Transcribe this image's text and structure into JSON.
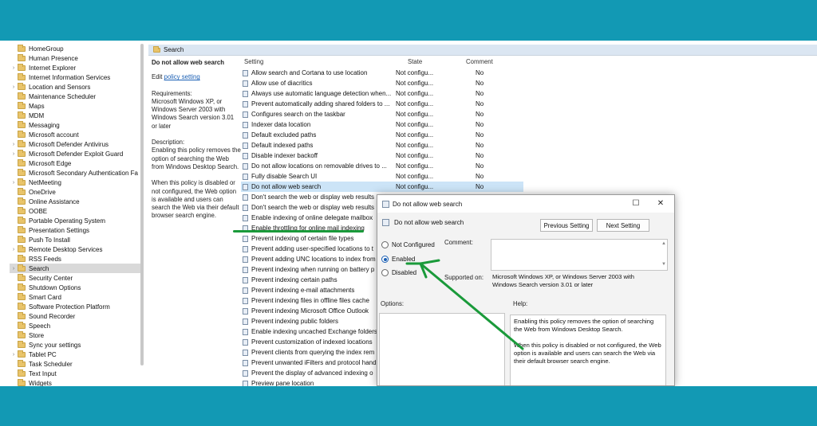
{
  "tree": {
    "items": [
      {
        "label": "HomeGroup",
        "expandable": false
      },
      {
        "label": "Human Presence",
        "expandable": false
      },
      {
        "label": "Internet Explorer",
        "expandable": true
      },
      {
        "label": "Internet Information Services",
        "expandable": false
      },
      {
        "label": "Location and Sensors",
        "expandable": true
      },
      {
        "label": "Maintenance Scheduler",
        "expandable": false
      },
      {
        "label": "Maps",
        "expandable": false
      },
      {
        "label": "MDM",
        "expandable": false
      },
      {
        "label": "Messaging",
        "expandable": false
      },
      {
        "label": "Microsoft account",
        "expandable": false
      },
      {
        "label": "Microsoft Defender Antivirus",
        "expandable": true
      },
      {
        "label": "Microsoft Defender Exploit Guard",
        "expandable": true
      },
      {
        "label": "Microsoft Edge",
        "expandable": false
      },
      {
        "label": "Microsoft Secondary Authentication Fa",
        "expandable": false
      },
      {
        "label": "NetMeeting",
        "expandable": true
      },
      {
        "label": "OneDrive",
        "expandable": false
      },
      {
        "label": "Online Assistance",
        "expandable": false
      },
      {
        "label": "OOBE",
        "expandable": false
      },
      {
        "label": "Portable Operating System",
        "expandable": false
      },
      {
        "label": "Presentation Settings",
        "expandable": false
      },
      {
        "label": "Push To Install",
        "expandable": false
      },
      {
        "label": "Remote Desktop Services",
        "expandable": true
      },
      {
        "label": "RSS Feeds",
        "expandable": false
      },
      {
        "label": "Search",
        "expandable": true,
        "selected": true
      },
      {
        "label": "Security Center",
        "expandable": false
      },
      {
        "label": "Shutdown Options",
        "expandable": false
      },
      {
        "label": "Smart Card",
        "expandable": false
      },
      {
        "label": "Software Protection Platform",
        "expandable": false
      },
      {
        "label": "Sound Recorder",
        "expandable": false
      },
      {
        "label": "Speech",
        "expandable": false
      },
      {
        "label": "Store",
        "expandable": false
      },
      {
        "label": "Sync your settings",
        "expandable": false
      },
      {
        "label": "Tablet PC",
        "expandable": true
      },
      {
        "label": "Task Scheduler",
        "expandable": false
      },
      {
        "label": "Text Input",
        "expandable": false
      },
      {
        "label": "Widgets",
        "expandable": false
      }
    ]
  },
  "pane": {
    "header": "Search",
    "desc": {
      "title": "Do not allow web search",
      "edit_prefix": "Edit ",
      "edit_link": "policy setting",
      "requirements": "Requirements:\nMicrosoft Windows XP, or Windows Server 2003 with Windows Search version 3.01 or later",
      "description": "Description:\nEnabling this policy removes the option of searching the Web from Windows Desktop Search.",
      "description2": "When this policy is disabled or not configured, the Web option is available and users can search the Web via their default browser search engine."
    }
  },
  "list": {
    "headers": {
      "setting": "Setting",
      "state": "State",
      "comment": "Comment"
    },
    "rows": [
      {
        "name": "Allow search and Cortana to use location",
        "state": "Not configu...",
        "comment": "No"
      },
      {
        "name": "Allow use of diacritics",
        "state": "Not configu...",
        "comment": "No"
      },
      {
        "name": "Always use automatic language detection when...",
        "state": "Not configu...",
        "comment": "No"
      },
      {
        "name": "Prevent automatically adding shared folders to ...",
        "state": "Not configu...",
        "comment": "No"
      },
      {
        "name": "Configures search on the taskbar",
        "state": "Not configu...",
        "comment": "No"
      },
      {
        "name": "Indexer data location",
        "state": "Not configu...",
        "comment": "No"
      },
      {
        "name": "Default excluded paths",
        "state": "Not configu...",
        "comment": "No"
      },
      {
        "name": "Default indexed paths",
        "state": "Not configu...",
        "comment": "No"
      },
      {
        "name": "Disable indexer backoff",
        "state": "Not configu...",
        "comment": "No"
      },
      {
        "name": "Do not allow locations on removable drives to ...",
        "state": "Not configu...",
        "comment": "No"
      },
      {
        "name": "Fully disable Search UI",
        "state": "Not configu...",
        "comment": "No"
      },
      {
        "name": "Do not allow web search",
        "state": "Not configu...",
        "comment": "No",
        "highlight": true
      },
      {
        "name": "Don't search the web or display web results",
        "state": "",
        "comment": ""
      },
      {
        "name": "Don't search the web or display web results",
        "state": "",
        "comment": ""
      },
      {
        "name": "Enable indexing of online delegate mailbox",
        "state": "",
        "comment": ""
      },
      {
        "name": "Enable throttling for online mail indexing",
        "state": "",
        "comment": ""
      },
      {
        "name": "Prevent indexing of certain file types",
        "state": "",
        "comment": ""
      },
      {
        "name": "Prevent adding user-specified locations to t",
        "state": "",
        "comment": ""
      },
      {
        "name": "Prevent adding UNC locations to index from",
        "state": "",
        "comment": ""
      },
      {
        "name": "Prevent indexing when running on battery p",
        "state": "",
        "comment": ""
      },
      {
        "name": "Prevent indexing certain paths",
        "state": "",
        "comment": ""
      },
      {
        "name": "Prevent indexing e-mail attachments",
        "state": "",
        "comment": ""
      },
      {
        "name": "Prevent indexing files in offline files cache",
        "state": "",
        "comment": ""
      },
      {
        "name": "Prevent indexing Microsoft Office Outlook",
        "state": "",
        "comment": ""
      },
      {
        "name": "Prevent indexing public folders",
        "state": "",
        "comment": ""
      },
      {
        "name": "Enable indexing uncached Exchange folders",
        "state": "",
        "comment": ""
      },
      {
        "name": "Prevent customization of indexed locations",
        "state": "",
        "comment": ""
      },
      {
        "name": "Prevent clients from querying the index rem",
        "state": "",
        "comment": ""
      },
      {
        "name": "Prevent unwanted iFilters and protocol hand",
        "state": "",
        "comment": ""
      },
      {
        "name": "Prevent the display of advanced indexing o",
        "state": "",
        "comment": ""
      },
      {
        "name": "Preview pane location",
        "state": "",
        "comment": ""
      }
    ]
  },
  "dialog": {
    "title": "Do not allow web search",
    "subtitle": "Do not allow web search",
    "prev_button": "Previous Setting",
    "next_button": "Next Setting",
    "options": {
      "not_configured": "Not Configured",
      "enabled": "Enabled",
      "disabled": "Disabled",
      "selected": "enabled"
    },
    "comment_label": "Comment:",
    "supported_label": "Supported on:",
    "supported_value": "Microsoft Windows XP, or Windows Server 2003 with Windows Search version 3.01 or later",
    "options_label": "Options:",
    "help_label": "Help:",
    "help_text1": "Enabling this policy removes the option of searching the Web from Windows Desktop Search.",
    "help_text2": "When this policy is disabled or not configured, the Web option is available and users can search the Web via their default browser search engine."
  },
  "annotation": {
    "color": "#1a9a3a"
  },
  "colors": {
    "brand_band": "#1299b4",
    "selection": "#cce4f7",
    "header": "#dbe6f2"
  }
}
